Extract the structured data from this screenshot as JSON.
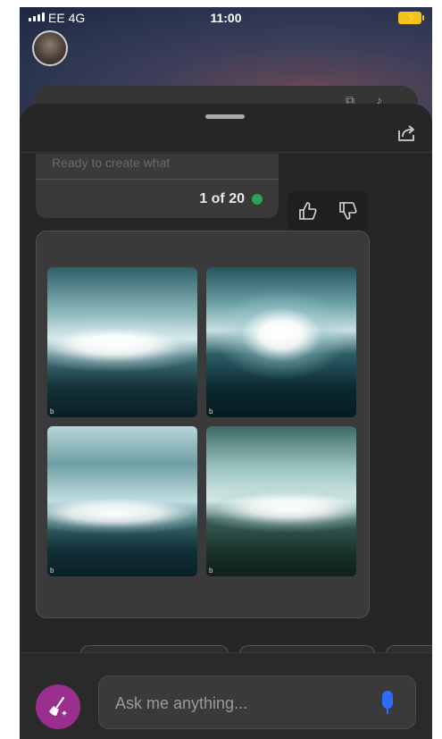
{
  "status_bar": {
    "carrier": "EE",
    "network": "4G",
    "time": "11:00"
  },
  "conversation": {
    "faded_text": "Ready to create what",
    "counter": "1 of 20",
    "counter_dot_color": "#2ea44f"
  },
  "images": [
    {
      "mark": "b",
      "alt": "generated image 1"
    },
    {
      "mark": "b",
      "alt": "generated image 2"
    },
    {
      "mark": "b",
      "alt": "generated image 3"
    },
    {
      "mark": "b",
      "alt": "generated image 4"
    }
  ],
  "composer": {
    "placeholder": "Ask me anything...",
    "accent_color": "#9b2f8f",
    "mic_color": "#2f6bff"
  },
  "icons": {
    "share": "share-icon",
    "thumbs_up": "thumbs-up-icon",
    "thumbs_down": "thumbs-down-icon",
    "broom": "broom-icon",
    "mic": "microphone-icon"
  }
}
